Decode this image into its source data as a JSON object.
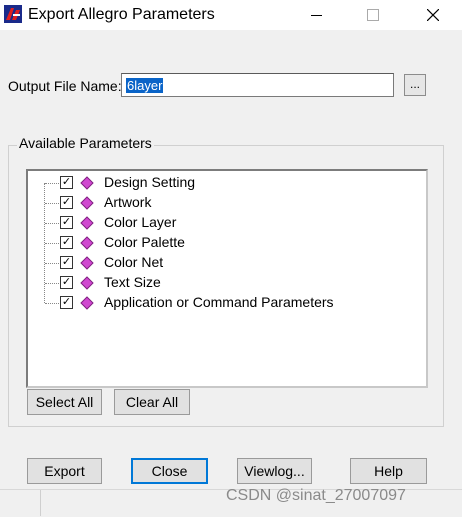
{
  "window": {
    "title": "Export Allegro Parameters",
    "controls": {
      "minimize": "—",
      "maximize": "☐",
      "close": "✕"
    }
  },
  "output_file": {
    "label": "Output File Name:",
    "value": "6layer",
    "browse_label": "..."
  },
  "parameters": {
    "group_title": "Available Parameters",
    "items": [
      {
        "label": "Design Setting",
        "checked": true
      },
      {
        "label": "Artwork",
        "checked": true
      },
      {
        "label": "Color Layer",
        "checked": true
      },
      {
        "label": "Color Palette",
        "checked": true
      },
      {
        "label": "Color Net",
        "checked": true
      },
      {
        "label": "Text Size",
        "checked": true
      },
      {
        "label": "Application or Command Parameters",
        "checked": true
      }
    ],
    "select_all_label": "Select All",
    "clear_all_label": "Clear All"
  },
  "buttons": {
    "export": "Export",
    "close": "Close",
    "viewlog": "Viewlog...",
    "help": "Help"
  },
  "watermark": "CSDN @sinat_27007097",
  "colors": {
    "selection": "#0a64c8",
    "focus_border": "#0078d7",
    "item_icon": "#d048d0"
  }
}
